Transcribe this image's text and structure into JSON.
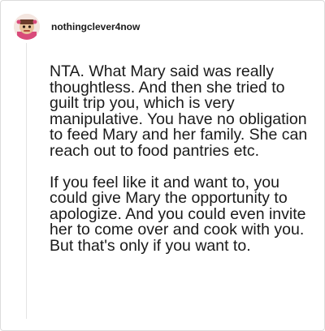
{
  "post": {
    "username": "nothingclever4now",
    "paragraphs": [
      "NTA. What Mary said was really thoughtless. And then she tried to guilt trip you, which is very manipulative. You have no obligation to feed Mary and her family. She can reach out to food pantries etc.",
      "If you feel like it and want to, you could give Mary the opportunity to apologize. And you could even invite her to come over and cook with you. But that's only if you want to."
    ]
  },
  "colors": {
    "text": "#1a1a1a",
    "border": "#dcdcdc",
    "avatar_bg": "#f4e6e0",
    "avatar_ribbon": "#d94a7a"
  }
}
